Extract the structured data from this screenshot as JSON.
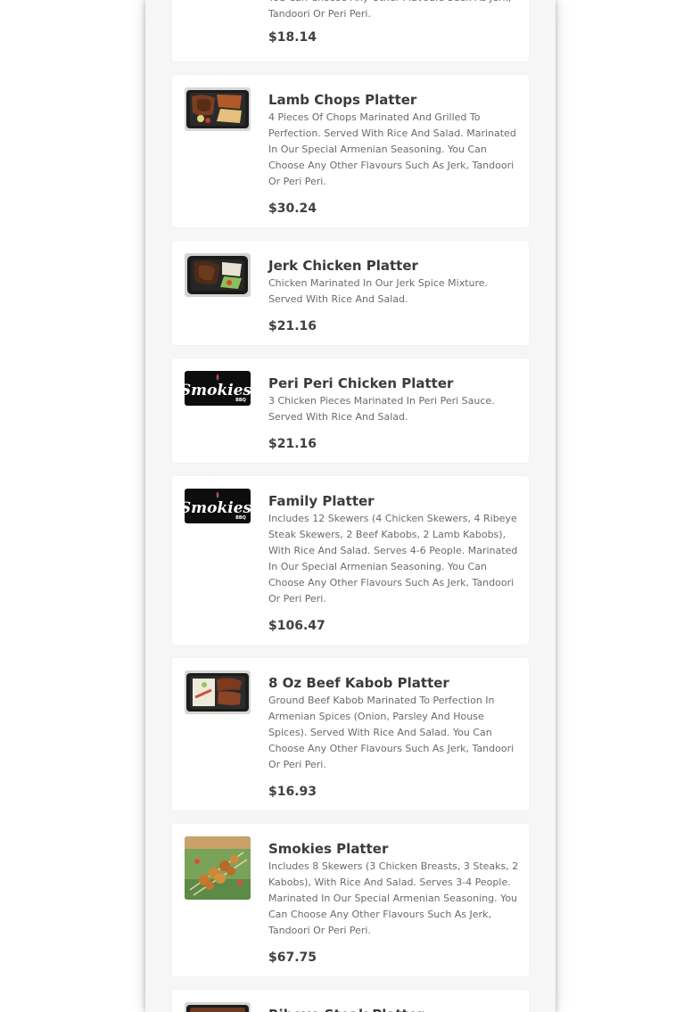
{
  "menu_items": [
    {
      "title": "",
      "description": "You Can Choose Any Other Flavours Such As Jerk, Tandoori Or Peri Peri.",
      "price": "$18.14",
      "image": "platter-photo"
    },
    {
      "title": "Lamb Chops Platter",
      "description": "4 Pieces Of Chops Marinated And Grilled To Perfection. Served With Rice And Salad. Marinated In Our Special Armenian Seasoning. You Can Choose Any Other Flavours Such As Jerk, Tandoori Or Peri Peri.",
      "price": "$30.24",
      "image": "platter-photo"
    },
    {
      "title": "Jerk Chicken Platter",
      "description": "Chicken Marinated In Our Jerk Spice Mixture. Served With Rice And Salad.",
      "price": "$21.16",
      "image": "platter-photo"
    },
    {
      "title": "Peri Peri Chicken Platter",
      "description": "3 Chicken Pieces Marinated In Peri Peri Sauce. Served With Rice And Salad.",
      "price": "$21.16",
      "image": "smokies-logo"
    },
    {
      "title": "Family Platter",
      "description": "Includes 12 Skewers (4 Chicken Skewers, 4 Ribeye Steak Skewers, 2 Beef Kabobs, 2 Lamb Kabobs), With Rice And Salad. Serves 4-6 People. Marinated In Our Special Armenian Seasoning. You Can Choose Any Other Flavours Such As Jerk, Tandoori Or Peri Peri.",
      "price": "$106.47",
      "image": "smokies-logo"
    },
    {
      "title": "8 Oz Beef Kabob Platter",
      "description": "Ground Beef Kabob Marinated To Perfection In Armenian Spices (Onion, Parsley And House Spices). Served With Rice And Salad. You Can Choose Any Other Flavours Such As Jerk, Tandoori Or Peri Peri.",
      "price": "$16.93",
      "image": "platter-photo"
    },
    {
      "title": "Smokies Platter",
      "description": "Includes 8 Skewers (3 Chicken Breasts, 3 Steaks, 2 Kabobs), With Rice And Salad. Serves 3-4 People. Marinated In Our Special Armenian Seasoning. You Can Choose Any Other Flavours Such As Jerk, Tandoori Or Peri Peri.",
      "price": "$67.75",
      "image": "skewers-photo"
    },
    {
      "title": "Ribeye Steak Platter",
      "description": "",
      "price": "",
      "image": "platter-photo"
    }
  ],
  "logo": {
    "wordmark": "Smokies",
    "sub": "BBQ"
  },
  "colors": {
    "card_bg": "#ffffff",
    "panel_bg": "#f6f6f6",
    "title": "#3b3b3b",
    "description": "#6b6b6b",
    "price": "#404040",
    "logo_bg": "#0d0d0d"
  }
}
